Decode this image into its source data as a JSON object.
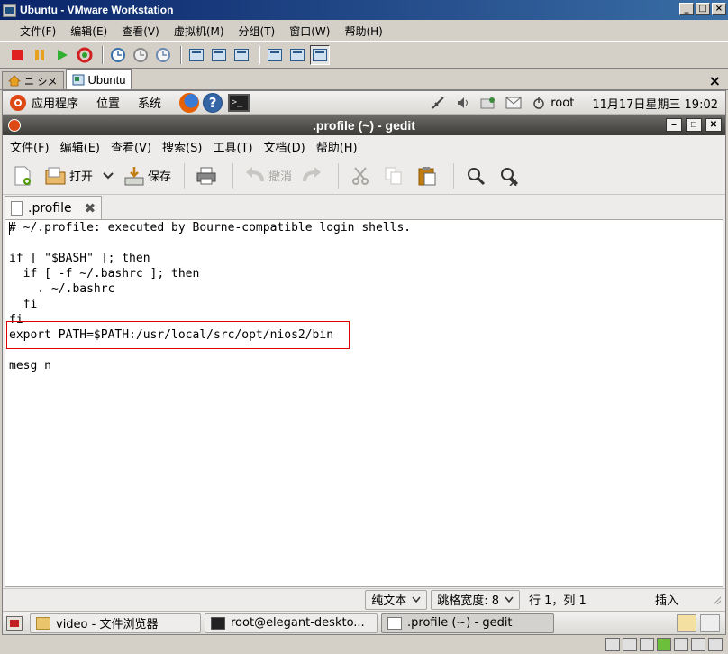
{
  "vmware": {
    "title": "Ubuntu - VMware Workstation",
    "menu": [
      "文件(F)",
      "编辑(E)",
      "查看(V)",
      "虚拟机(M)",
      "分组(T)",
      "窗口(W)",
      "帮助(H)"
    ],
    "tabs": [
      {
        "label": "ニ シメ"
      },
      {
        "label": "Ubuntu"
      }
    ],
    "close_tab_symbol": "×"
  },
  "gnome_top_panel": {
    "menus": [
      "应用程序",
      "位置",
      "系统"
    ],
    "help_glyph": "?",
    "terminal_glyph": ">_",
    "user": "root",
    "clock": "11月17日星期三 19:02"
  },
  "gedit": {
    "title": ".profile (~) - gedit",
    "menu": [
      "文件(F)",
      "编辑(E)",
      "查看(V)",
      "搜索(S)",
      "工具(T)",
      "文档(D)",
      "帮助(H)"
    ],
    "toolbar": {
      "open_label": "打开",
      "save_label": "保存",
      "undo_label": "撤消"
    },
    "tab_label": ".profile",
    "tab_close": "✖",
    "lines": [
      "# ~/.profile: executed by Bourne-compatible login shells.",
      "",
      "if [ \"$BASH\" ]; then",
      "  if [ -f ~/.bashrc ]; then",
      "    . ~/.bashrc",
      "  fi",
      "fi",
      "export PATH=$PATH:/usr/local/src/opt/nios2/bin",
      "",
      "mesg n"
    ],
    "status": {
      "language": "纯文本",
      "tab_width": "跳格宽度: 8",
      "position": "行 1，列 1",
      "mode": "插入"
    }
  },
  "gnome_bottom_panel": {
    "tasks": [
      {
        "label": "video - 文件浏览器"
      },
      {
        "label": "root@elegant-deskto..."
      },
      {
        "label": ".profile (~) - gedit"
      }
    ]
  },
  "colors": {
    "highlight_border": "#e00000",
    "gedit_title_bg": "#3c3b37",
    "ubuntu_orange": "#dd4814"
  }
}
